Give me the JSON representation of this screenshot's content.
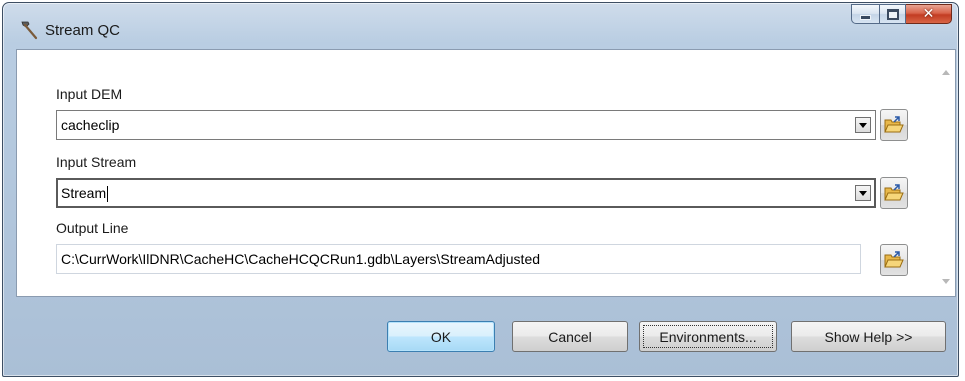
{
  "window": {
    "title": "Stream QC",
    "title_icon": "hammer-tool-icon",
    "caption_icons": [
      "minimize-icon",
      "maximize-icon",
      "close-icon"
    ]
  },
  "fields": {
    "input_dem": {
      "label": "Input DEM",
      "value": "cacheclip",
      "dropdown_icon": "chevron-down-icon",
      "browse_icon": "open-folder-icon"
    },
    "input_stream": {
      "label": "Input Stream",
      "value": "Stream",
      "dropdown_icon": "chevron-down-icon",
      "browse_icon": "open-folder-icon"
    },
    "output_line": {
      "label": "Output Line",
      "value": "C:\\CurrWork\\IlDNR\\CacheHC\\CacheHCQCRun1.gdb\\Layers\\StreamAdjusted",
      "browse_icon": "open-folder-icon"
    }
  },
  "buttons": {
    "ok": "OK",
    "cancel": "Cancel",
    "environments": "Environments...",
    "show_help": "Show Help >>"
  },
  "colors": {
    "frame": "#b9cde2",
    "default_button": "#bee6fd",
    "close_button": "#c23c22"
  }
}
